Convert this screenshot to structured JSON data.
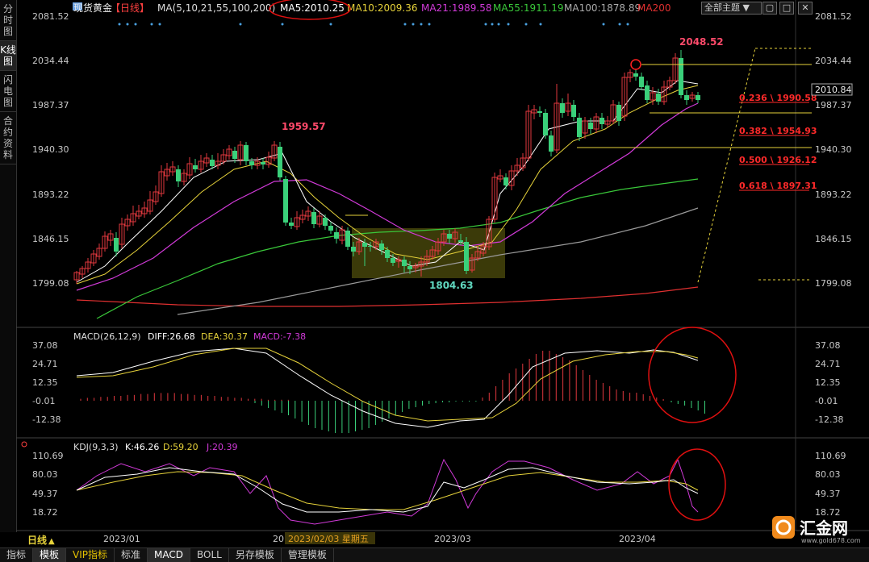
{
  "left_tabs": [
    "分时图",
    "K线图",
    "闪电图",
    "合约资料"
  ],
  "header": {
    "symbol": "现货黄金",
    "period": "【日线】",
    "ma_label": "MA(5,10,21,55,100,200)",
    "ma5": "MA5:2010.25",
    "ma10": "MA10:2009.36",
    "ma21": "MA21:1989.58",
    "ma55": "MA55:1911.19",
    "ma100": "MA100:1878.89",
    "ma200": "MA200",
    "theme_button": "全部主题 ▼"
  },
  "colors": {
    "up": "#e0383e",
    "down": "#3ad07a",
    "ma5": "#ffffff",
    "ma10": "#e6d23a",
    "ma21": "#d13ad8",
    "ma55": "#3ac83a",
    "ma100": "#9a9a9a",
    "ma200": "#e03030",
    "fib": "#ff2a2a",
    "axis": "#c8c8c8",
    "annotation": "#e01010"
  },
  "price_axis": [
    "2081.52",
    "2034.44",
    "1987.37",
    "1940.30",
    "1893.22",
    "1846.15",
    "1799.08"
  ],
  "last_price": "2010.84",
  "annotations": {
    "high": "2048.52",
    "peak": "1959.57",
    "low": "1804.63"
  },
  "fib_levels": [
    "0.236 \\ 1990.58",
    "0.382 \\ 1954.93",
    "0.500 \\ 1926.12",
    "0.618 \\ 1897.31"
  ],
  "macd": {
    "label": "MACD(26,12,9)",
    "diff": "DIFF:26.68",
    "dea": "DEA:30.37",
    "macd": "MACD:-7.38",
    "axis": [
      "37.08",
      "24.71",
      "12.35",
      "-0.01",
      "-12.38"
    ]
  },
  "kdj": {
    "label": "KDJ(9,3,3)",
    "k": "K:46.26",
    "d": "D:59.20",
    "j": "J:20.39",
    "axis": [
      "110.69",
      "80.03",
      "49.37",
      "18.72"
    ]
  },
  "date_axis": {
    "period_tag": "日线",
    "labels": [
      "2023/01",
      "20",
      "2023/03",
      "2023/04"
    ],
    "cursor": "2023/02/03 星期五"
  },
  "bottom_tabs": [
    "指标",
    "模板",
    "VIP指标",
    "标准",
    "MACD",
    "BOLL",
    "另存模板",
    "管理模板"
  ],
  "logo": {
    "name": "汇金网",
    "url": "www.gold678.com"
  }
}
